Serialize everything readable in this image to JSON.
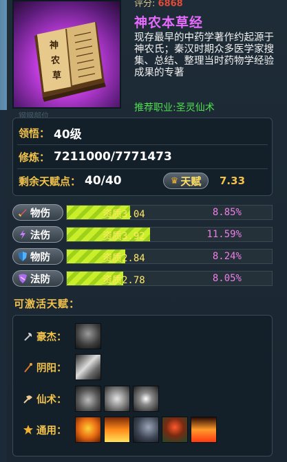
{
  "book": {
    "score_label": "评分:",
    "score_value": "6868",
    "name": "神农本草经",
    "description": "现存最早的中药学著作约起源于神农氏；秦汉时期众多医学家搜集、总结、整理当时药物学经验成果的专著",
    "recommend": "推荐职业:圣灵仙术",
    "ghost": "钢钢部位"
  },
  "stats": {
    "comprehension_label": "领悟：",
    "comprehension_value": "40级",
    "cultivation_label": "修炼：",
    "cultivation_value": "7211000/7771473",
    "points_label": "剩余天赋点：",
    "points_value": "40/40",
    "talent_button": "天赋",
    "talent_score": "7.33"
  },
  "attributes": [
    {
      "name": "物伤",
      "quality_label": "资质",
      "quality": "3.04",
      "quality_fill": 0.28,
      "percent": "8.85%",
      "icon": "sword-icon",
      "color": "#e2564a"
    },
    {
      "name": "法伤",
      "quality_label": "资质",
      "quality": "3.92",
      "quality_fill": 0.37,
      "percent": "11.59%",
      "icon": "lightning-icon",
      "color": "#c97cff"
    },
    {
      "name": "物防",
      "quality_label": "资质",
      "quality": "2.84",
      "quality_fill": 0.26,
      "percent": "8.24%",
      "icon": "shield-icon",
      "color": "#4fb3ff"
    },
    {
      "name": "法防",
      "quality_label": "资质",
      "quality": "2.78",
      "quality_fill": 0.25,
      "percent": "8.05%",
      "icon": "magic-shield-icon",
      "color": "#d58cff"
    }
  ],
  "section_title": "可激活天赋：",
  "schools": [
    {
      "name": "豪杰：",
      "icon": "axe-icon",
      "skills": [
        "warrior-skill-icon"
      ]
    },
    {
      "name": "阴阳：",
      "icon": "staff-icon",
      "skills": [
        "wind-slash-skill-icon"
      ]
    },
    {
      "name": "仙术：",
      "icon": "fan-icon",
      "skills": [
        "flame-wing-skill-icon",
        "yin-yang-skill-icon",
        "burst-skill-icon"
      ]
    },
    {
      "name": "通用：",
      "icon": "star-icon",
      "skills": [
        "fire-face-skill-icon",
        "rising-flame-skill-icon",
        "dragon-skill-icon",
        "aura-body-skill-icon",
        "flame-crown-skill-icon"
      ]
    }
  ],
  "colors": {
    "accent": "#f2c24a",
    "book_name": "#e86bff",
    "recommend": "#4fe04f",
    "percent": "#f07dea"
  }
}
